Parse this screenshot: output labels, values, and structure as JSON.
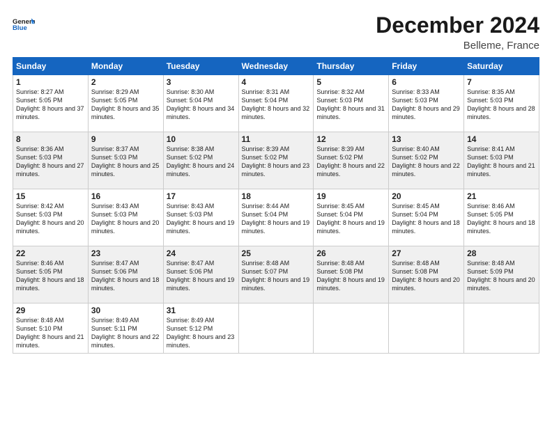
{
  "logo": {
    "line1": "General",
    "line2": "Blue"
  },
  "title": "December 2024",
  "location": "Belleme, France",
  "headers": [
    "Sunday",
    "Monday",
    "Tuesday",
    "Wednesday",
    "Thursday",
    "Friday",
    "Saturday"
  ],
  "weeks": [
    [
      {
        "day": "1",
        "sunrise": "Sunrise: 8:27 AM",
        "sunset": "Sunset: 5:05 PM",
        "daylight": "Daylight: 8 hours and 37 minutes."
      },
      {
        "day": "2",
        "sunrise": "Sunrise: 8:29 AM",
        "sunset": "Sunset: 5:05 PM",
        "daylight": "Daylight: 8 hours and 35 minutes."
      },
      {
        "day": "3",
        "sunrise": "Sunrise: 8:30 AM",
        "sunset": "Sunset: 5:04 PM",
        "daylight": "Daylight: 8 hours and 34 minutes."
      },
      {
        "day": "4",
        "sunrise": "Sunrise: 8:31 AM",
        "sunset": "Sunset: 5:04 PM",
        "daylight": "Daylight: 8 hours and 32 minutes."
      },
      {
        "day": "5",
        "sunrise": "Sunrise: 8:32 AM",
        "sunset": "Sunset: 5:03 PM",
        "daylight": "Daylight: 8 hours and 31 minutes."
      },
      {
        "day": "6",
        "sunrise": "Sunrise: 8:33 AM",
        "sunset": "Sunset: 5:03 PM",
        "daylight": "Daylight: 8 hours and 29 minutes."
      },
      {
        "day": "7",
        "sunrise": "Sunrise: 8:35 AM",
        "sunset": "Sunset: 5:03 PM",
        "daylight": "Daylight: 8 hours and 28 minutes."
      }
    ],
    [
      {
        "day": "8",
        "sunrise": "Sunrise: 8:36 AM",
        "sunset": "Sunset: 5:03 PM",
        "daylight": "Daylight: 8 hours and 27 minutes."
      },
      {
        "day": "9",
        "sunrise": "Sunrise: 8:37 AM",
        "sunset": "Sunset: 5:03 PM",
        "daylight": "Daylight: 8 hours and 25 minutes."
      },
      {
        "day": "10",
        "sunrise": "Sunrise: 8:38 AM",
        "sunset": "Sunset: 5:02 PM",
        "daylight": "Daylight: 8 hours and 24 minutes."
      },
      {
        "day": "11",
        "sunrise": "Sunrise: 8:39 AM",
        "sunset": "Sunset: 5:02 PM",
        "daylight": "Daylight: 8 hours and 23 minutes."
      },
      {
        "day": "12",
        "sunrise": "Sunrise: 8:39 AM",
        "sunset": "Sunset: 5:02 PM",
        "daylight": "Daylight: 8 hours and 22 minutes."
      },
      {
        "day": "13",
        "sunrise": "Sunrise: 8:40 AM",
        "sunset": "Sunset: 5:02 PM",
        "daylight": "Daylight: 8 hours and 22 minutes."
      },
      {
        "day": "14",
        "sunrise": "Sunrise: 8:41 AM",
        "sunset": "Sunset: 5:03 PM",
        "daylight": "Daylight: 8 hours and 21 minutes."
      }
    ],
    [
      {
        "day": "15",
        "sunrise": "Sunrise: 8:42 AM",
        "sunset": "Sunset: 5:03 PM",
        "daylight": "Daylight: 8 hours and 20 minutes."
      },
      {
        "day": "16",
        "sunrise": "Sunrise: 8:43 AM",
        "sunset": "Sunset: 5:03 PM",
        "daylight": "Daylight: 8 hours and 20 minutes."
      },
      {
        "day": "17",
        "sunrise": "Sunrise: 8:43 AM",
        "sunset": "Sunset: 5:03 PM",
        "daylight": "Daylight: 8 hours and 19 minutes."
      },
      {
        "day": "18",
        "sunrise": "Sunrise: 8:44 AM",
        "sunset": "Sunset: 5:04 PM",
        "daylight": "Daylight: 8 hours and 19 minutes."
      },
      {
        "day": "19",
        "sunrise": "Sunrise: 8:45 AM",
        "sunset": "Sunset: 5:04 PM",
        "daylight": "Daylight: 8 hours and 19 minutes."
      },
      {
        "day": "20",
        "sunrise": "Sunrise: 8:45 AM",
        "sunset": "Sunset: 5:04 PM",
        "daylight": "Daylight: 8 hours and 18 minutes."
      },
      {
        "day": "21",
        "sunrise": "Sunrise: 8:46 AM",
        "sunset": "Sunset: 5:05 PM",
        "daylight": "Daylight: 8 hours and 18 minutes."
      }
    ],
    [
      {
        "day": "22",
        "sunrise": "Sunrise: 8:46 AM",
        "sunset": "Sunset: 5:05 PM",
        "daylight": "Daylight: 8 hours and 18 minutes."
      },
      {
        "day": "23",
        "sunrise": "Sunrise: 8:47 AM",
        "sunset": "Sunset: 5:06 PM",
        "daylight": "Daylight: 8 hours and 18 minutes."
      },
      {
        "day": "24",
        "sunrise": "Sunrise: 8:47 AM",
        "sunset": "Sunset: 5:06 PM",
        "daylight": "Daylight: 8 hours and 19 minutes."
      },
      {
        "day": "25",
        "sunrise": "Sunrise: 8:48 AM",
        "sunset": "Sunset: 5:07 PM",
        "daylight": "Daylight: 8 hours and 19 minutes."
      },
      {
        "day": "26",
        "sunrise": "Sunrise: 8:48 AM",
        "sunset": "Sunset: 5:08 PM",
        "daylight": "Daylight: 8 hours and 19 minutes."
      },
      {
        "day": "27",
        "sunrise": "Sunrise: 8:48 AM",
        "sunset": "Sunset: 5:08 PM",
        "daylight": "Daylight: 8 hours and 20 minutes."
      },
      {
        "day": "28",
        "sunrise": "Sunrise: 8:48 AM",
        "sunset": "Sunset: 5:09 PM",
        "daylight": "Daylight: 8 hours and 20 minutes."
      }
    ],
    [
      {
        "day": "29",
        "sunrise": "Sunrise: 8:48 AM",
        "sunset": "Sunset: 5:10 PM",
        "daylight": "Daylight: 8 hours and 21 minutes."
      },
      {
        "day": "30",
        "sunrise": "Sunrise: 8:49 AM",
        "sunset": "Sunset: 5:11 PM",
        "daylight": "Daylight: 8 hours and 22 minutes."
      },
      {
        "day": "31",
        "sunrise": "Sunrise: 8:49 AM",
        "sunset": "Sunset: 5:12 PM",
        "daylight": "Daylight: 8 hours and 23 minutes."
      },
      null,
      null,
      null,
      null
    ]
  ]
}
